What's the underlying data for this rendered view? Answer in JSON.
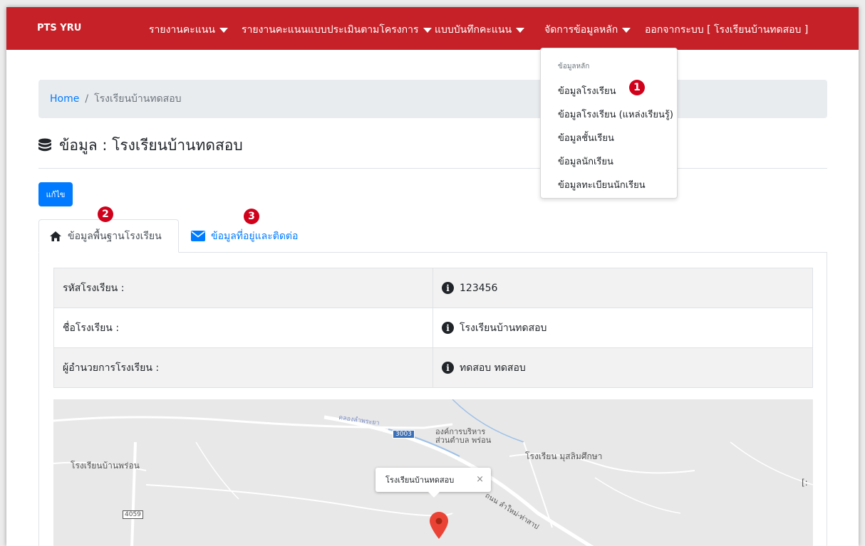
{
  "navbar": {
    "brand": "PTS YRU",
    "items": [
      {
        "label": "รายงานคะแนน"
      },
      {
        "label": "รายงานคะแนนแบบประเมินตามโครงการ"
      },
      {
        "label": "แบบบันทึกคะแนน"
      },
      {
        "label": "จัดการข้อมูลหลัก"
      }
    ],
    "logout": "ออกจากระบบ [ โรงเรียนบ้านทดสอบ ]"
  },
  "dropdown": {
    "header": "ข้อมูลหลัก",
    "items": [
      {
        "label": "ข้อมูลโรงเรียน"
      },
      {
        "label": "ข้อมูลโรงเรียน (แหล่งเรียนรู้)"
      },
      {
        "label": "ข้อมูลชั้นเรียน"
      },
      {
        "label": "ข้อมูลนักเรียน"
      },
      {
        "label": "ข้อมูลทะเบียนนักเรียน"
      }
    ]
  },
  "badges": [
    "1",
    "2",
    "3"
  ],
  "breadcrumb": {
    "home": "Home",
    "separator": "/",
    "current": "โรงเรียนบ้านทดสอบ"
  },
  "page": {
    "title": "ข้อมูล : โรงเรียนบ้านทดสอบ",
    "edit_label": "แก้ไข"
  },
  "tabs": [
    {
      "label": "ข้อมูลพื้นฐานโรงเรียน",
      "icon": "home-icon"
    },
    {
      "label": "ข้อมูลที่อยู่และติดต่อ",
      "icon": "envelope-icon"
    }
  ],
  "table": {
    "rows": [
      {
        "label": "รหัสโรงเรียน :",
        "value": "123456"
      },
      {
        "label": "ชื่อโรงเรียน :",
        "value": "โรงเรียนบ้านทดสอบ"
      },
      {
        "label": "ผู้อำนวยการโรงเรียน :",
        "value": "ทดสอบ ทดสอบ"
      }
    ]
  },
  "map": {
    "canal": "คลองลำพระยา",
    "road_3003": "3003",
    "poi_tambon": "องค์การบริหาร\nส่วนตำบล พร่อน",
    "poi_school1": "โรงเรียนบ้านพร่อน",
    "poi_school2": "โรงเรียน มุสลิมศึกษา",
    "road_4": "4059",
    "road_name": "ถนน ลำใหม่-ท่าสาป",
    "popup": "โรงเรียนบ้านทดสอบ",
    "popup_close": "×",
    "edge_label": "โ",
    "edge_label2": "[:"
  },
  "colors": {
    "navbar": "#c62128",
    "link": "#007bff",
    "badge": "#d0021b",
    "marker": "#ea4335"
  }
}
